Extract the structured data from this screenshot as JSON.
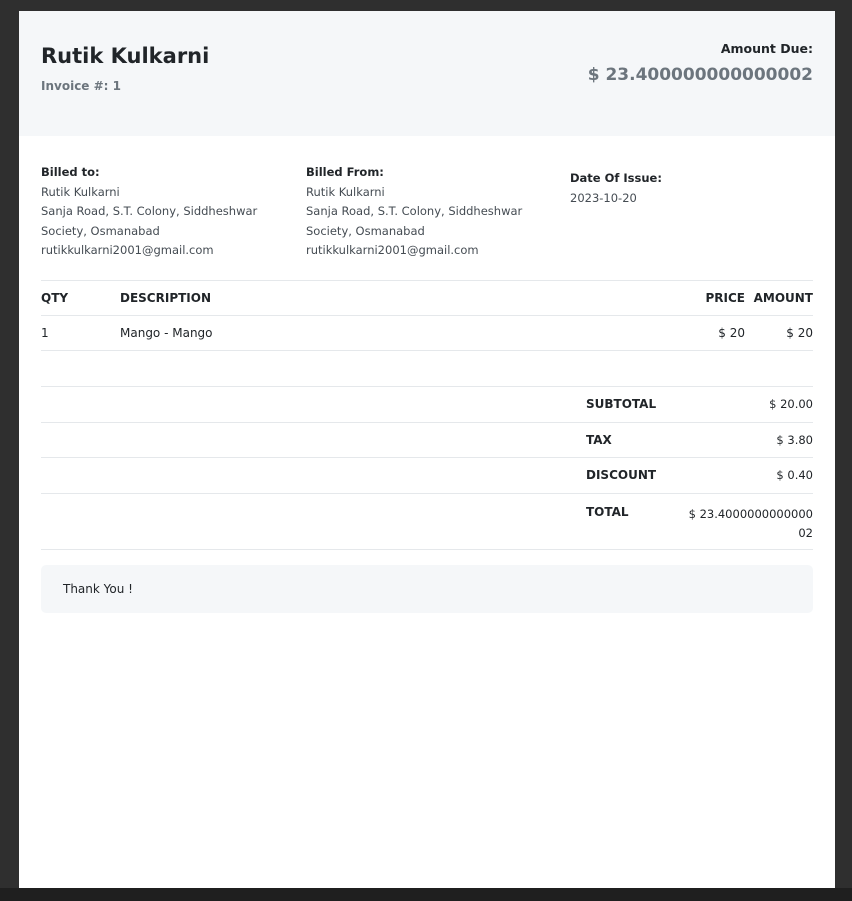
{
  "invoice": {
    "business_name": "Rutik Kulkarni",
    "invoice_label": "Invoice #: 1",
    "amount_due_label": "Amount Due:",
    "amount_due_value": "$ 23.400000000000002"
  },
  "billed_to": {
    "title": "Billed to:",
    "name": "Rutik Kulkarni",
    "address_1": "Sanja Road, S.T. Colony, Siddheshwar",
    "address_2": "Society, Osmanabad",
    "email": "rutikkulkarni2001@gmail.com"
  },
  "billed_from": {
    "title": "Billed From:",
    "name": "Rutik Kulkarni",
    "address_1": "Sanja Road, S.T. Colony, Siddheshwar",
    "address_2": "Society, Osmanabad",
    "email": "rutikkulkarni2001@gmail.com"
  },
  "issue": {
    "title": "Date Of Issue:",
    "date": "2023-10-20"
  },
  "items_table": {
    "headers": [
      "QTY",
      "DESCRIPTION",
      "PRICE",
      "AMOUNT"
    ],
    "rows": [
      {
        "qty": "1",
        "description": "Mango - Mango",
        "price": "$ 20",
        "amount": "$ 20"
      }
    ]
  },
  "totals": {
    "subtotal_label": "SUBTOTAL",
    "subtotal_value": "$ 20.00",
    "tax_label": "TAX",
    "tax_value": "$ 3.80",
    "discount_label": "DISCOUNT",
    "discount_value": "$ 0.40",
    "total_label": "TOTAL",
    "total_value": "$ 23.400000000000002"
  },
  "note": "Thank You !",
  "colors": {
    "header_bg": "#f5f7f9",
    "muted_text": "#6c757d",
    "page_bg": "#2f2f2f"
  }
}
